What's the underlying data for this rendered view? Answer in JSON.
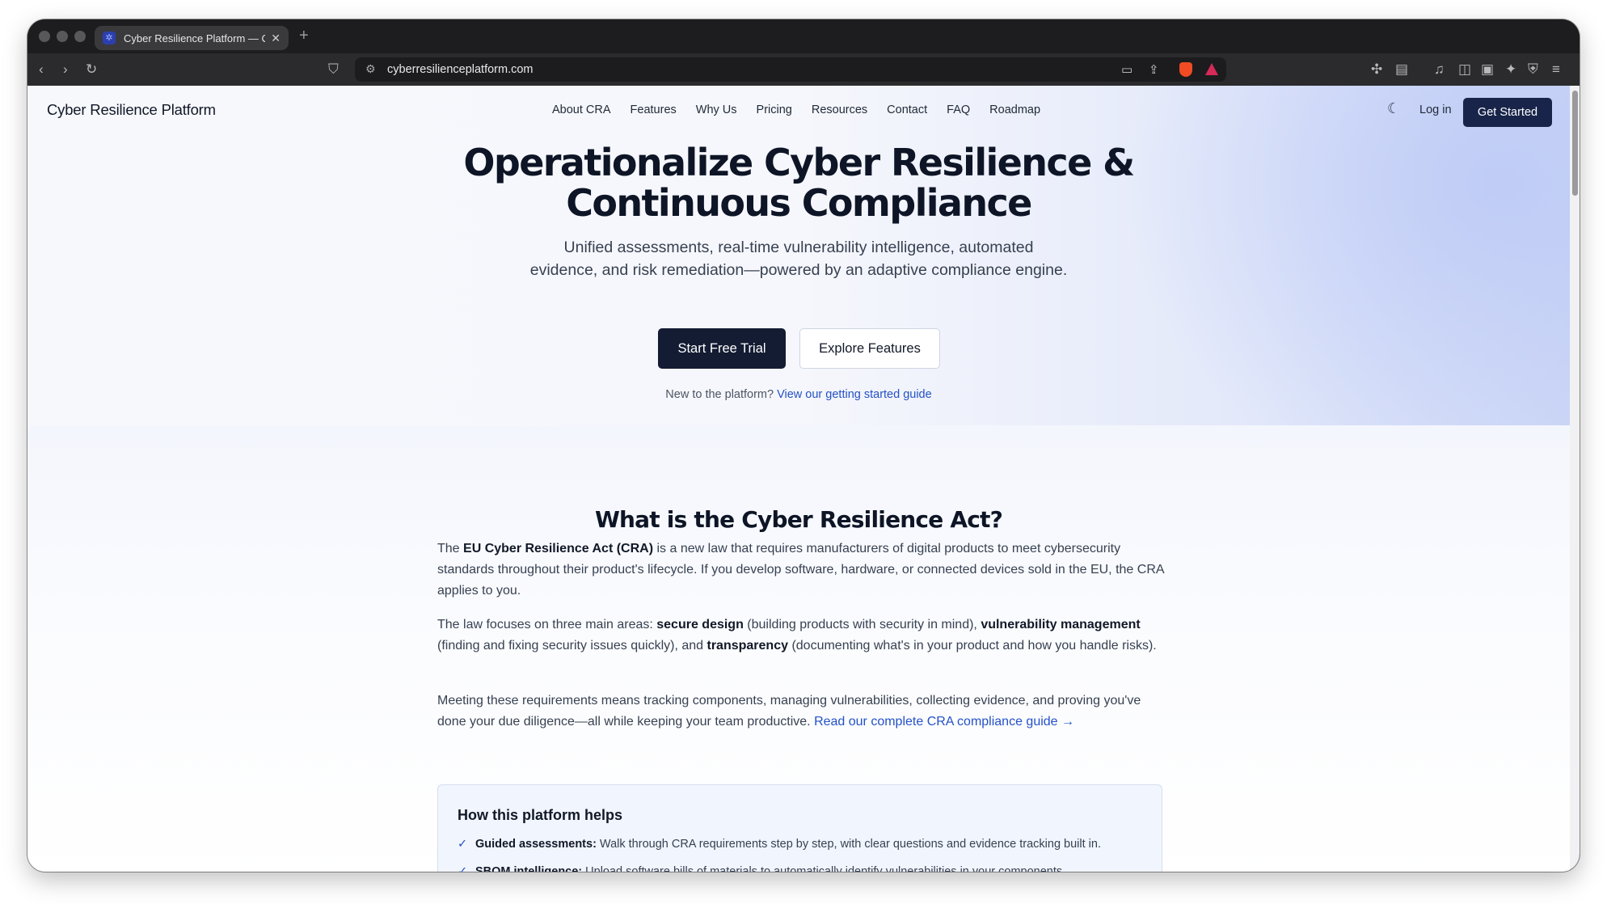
{
  "browser": {
    "tab_title": "Cyber Resilience Platform — C",
    "tab_favicon": "shield-favicon-icon",
    "url": "cyberresilienceplatform.com"
  },
  "header": {
    "brand": "Cyber Resilience Platform",
    "nav": [
      "About CRA",
      "Features",
      "Why Us",
      "Pricing",
      "Resources",
      "Contact",
      "FAQ",
      "Roadmap"
    ],
    "login": "Log in",
    "cta": "Get Started"
  },
  "hero": {
    "title_line1": "Operationalize Cyber Resilience &",
    "title_line2": "Continuous Compliance",
    "subtitle_line1": "Unified assessments, real-time vulnerability intelligence, automated",
    "subtitle_line2": "evidence, and risk remediation—powered by an adaptive compliance engine.",
    "primary_button": "Start Free Trial",
    "secondary_button": "Explore Features",
    "guide_prompt": "New to the platform?",
    "guide_link": "View our getting started guide"
  },
  "about": {
    "title": "What is the Cyber Resilience Act?",
    "p1_pre": "The ",
    "p1_bold": "EU Cyber Resilience Act (CRA)",
    "p1_post": " is a new law that requires manufacturers of digital products to meet cybersecurity standards throughout their product's lifecycle. If you develop software, hardware, or connected devices sold in the EU, the CRA applies to you.",
    "p2_pre": "The law focuses on three main areas: ",
    "p2_b1": "secure design",
    "p2_m1": " (building products with security in mind), ",
    "p2_b2": "vulnerability management",
    "p2_m2": " (finding and fixing security issues quickly), and ",
    "p2_b3": "transparency",
    "p2_post": " (documenting what's in your product and how you handle risks).",
    "p3_text": "Meeting these requirements means tracking components, managing vulnerabilities, collecting evidence, and proving you've done your due diligence—all while keeping your team productive. ",
    "p3_link": "Read our complete CRA compliance guide →"
  },
  "helps": {
    "title": "How this platform helps",
    "items": [
      {
        "label": "Guided assessments:",
        "text": " Walk through CRA requirements step by step, with clear questions and evidence tracking built in."
      },
      {
        "label": "SBOM intelligence:",
        "text": " Upload software bills of materials to automatically identify vulnerabilities in your components."
      }
    ]
  }
}
